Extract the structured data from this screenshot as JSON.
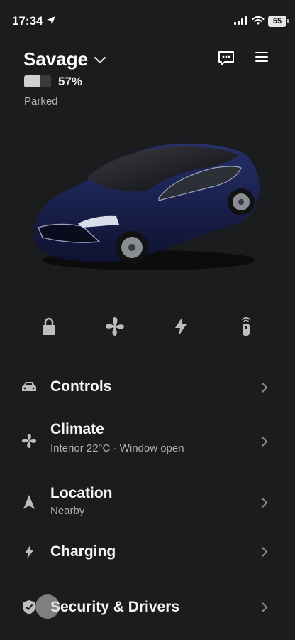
{
  "status_bar": {
    "time": "17:34",
    "battery": "55"
  },
  "header": {
    "car_name": "Savage",
    "battery_percent": "57%",
    "battery_level": 0.57,
    "status": "Parked"
  },
  "car": {
    "color": "#1a2244"
  },
  "quick_actions": [
    "lock-icon",
    "fan-icon",
    "bolt-icon",
    "remote-key-icon"
  ],
  "menu": [
    {
      "title": "Controls",
      "subtitle": "",
      "icon": "car-icon"
    },
    {
      "title": "Climate",
      "subtitle": "Interior 22°C · Window open",
      "icon": "fan-icon"
    },
    {
      "title": "Location",
      "subtitle": "Nearby",
      "icon": "location-arrow-icon"
    },
    {
      "title": "Charging",
      "subtitle": "",
      "icon": "bolt-icon"
    },
    {
      "title": "Security & Drivers",
      "subtitle": "",
      "icon": "shield-icon"
    }
  ],
  "colors": {
    "background": "#1b1c1e",
    "text": "#f5f5f5",
    "muted": "#b0b0b0",
    "icon": "#bdbdbd"
  }
}
